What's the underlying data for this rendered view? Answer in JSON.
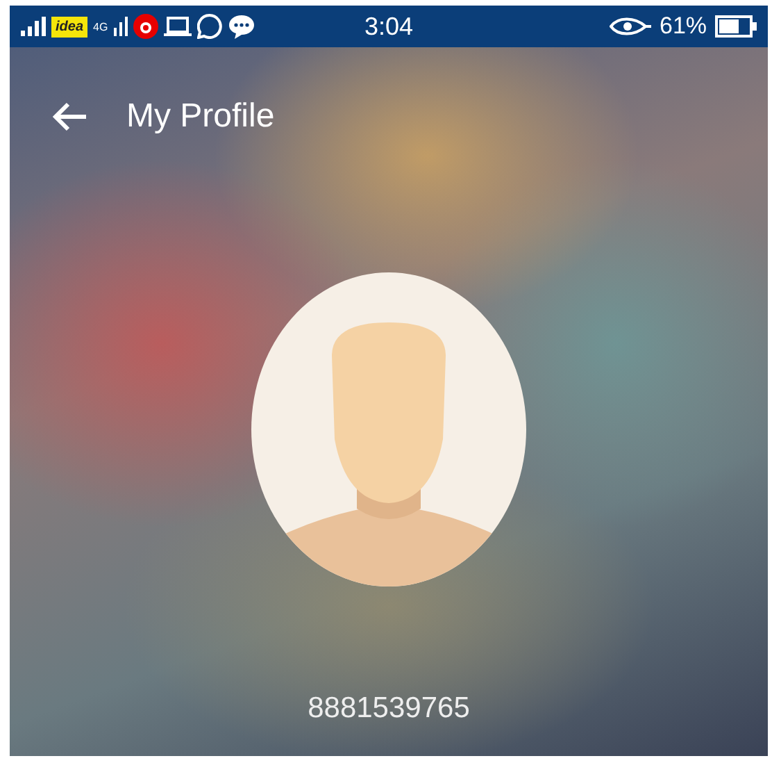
{
  "status_bar": {
    "carrier": "idea",
    "network": "4G",
    "time": "3:04",
    "battery": "61%"
  },
  "header": {
    "title": "My Profile"
  },
  "profile": {
    "phone": "8881539765"
  }
}
